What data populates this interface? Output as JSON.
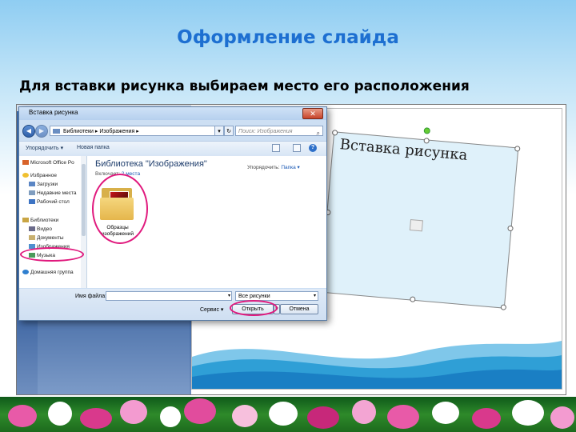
{
  "slide": {
    "title": "Оформление слайда",
    "subtitle": "Для вставки рисунка выбираем место его расположения"
  },
  "ppt": {
    "placeholder_title": "Вставка рисунка"
  },
  "dialog": {
    "title": "Вставка рисунка",
    "address": "Библиотеки ▸ Изображения ▸",
    "search_placeholder": "Поиск: Изображения",
    "toolbar": {
      "organize": "Упорядочить ▾",
      "new_folder": "Новая папка"
    },
    "nav": [
      {
        "label": "Microsoft Office Po",
        "icon": "office-icon"
      },
      {
        "label": "Избранное",
        "icon": "star-icon"
      },
      {
        "label": "Загрузки",
        "icon": "downloads-icon"
      },
      {
        "label": "Недавние места",
        "icon": "recent-places-icon"
      },
      {
        "label": "Рабочий стол",
        "icon": "desktop-icon"
      },
      {
        "label": "Библиотеки",
        "icon": "libraries-icon"
      },
      {
        "label": "Видео",
        "icon": "video-icon"
      },
      {
        "label": "Документы",
        "icon": "documents-icon"
      },
      {
        "label": "Изображения",
        "icon": "pictures-icon"
      },
      {
        "label": "Музыка",
        "icon": "music-icon"
      },
      {
        "label": "Домашняя группа",
        "icon": "homegroup-icon"
      }
    ],
    "library": {
      "title": "Библиотека \"Изображения\"",
      "includes_label": "Включает:",
      "includes_value": "2 места",
      "arrange_label": "Упорядочить:",
      "arrange_value": "Папка ▾"
    },
    "folder": {
      "name": "Образцы изображений"
    },
    "footer": {
      "filename_label": "Имя файла:",
      "filename_value": "",
      "filetype": "Все рисунки",
      "tools": "Сервис ▾",
      "open": "Открыть",
      "cancel": "Отмена"
    }
  },
  "colors": {
    "title": "#1d6fd1",
    "highlight_ring": "#e0197d"
  }
}
